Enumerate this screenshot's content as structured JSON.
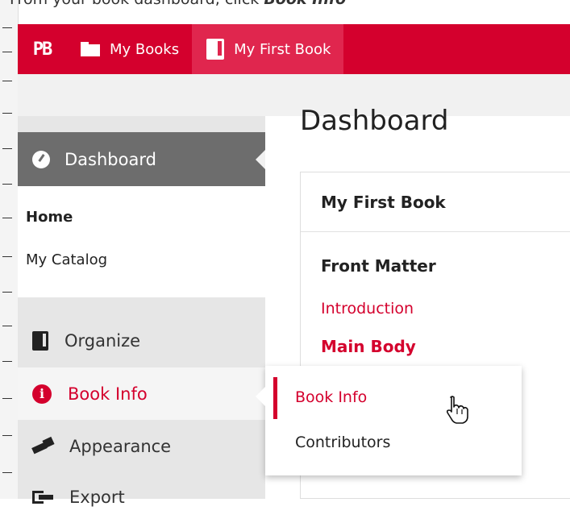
{
  "caption": {
    "prefix": "From your book dashboard, click ",
    "emphasis": "Book Info"
  },
  "adminbar": {
    "logo": "PB",
    "items": [
      {
        "label": "My Books",
        "icon": "folder-icon"
      },
      {
        "label": "My First Book",
        "icon": "book-icon"
      }
    ],
    "accent_color": "#d4002d"
  },
  "sidebar": {
    "current": {
      "label": "Dashboard",
      "icon": "gauge-icon"
    },
    "submenu": [
      {
        "label": "Home",
        "current": true
      },
      {
        "label": "My Catalog",
        "current": false
      }
    ],
    "items": [
      {
        "label": "Organize",
        "icon": "organize-icon"
      },
      {
        "label": "Book Info",
        "icon": "info-icon",
        "hover": true
      },
      {
        "label": "Appearance",
        "icon": "brush-icon"
      },
      {
        "label": "Export",
        "icon": "export-icon"
      }
    ]
  },
  "main": {
    "title": "Dashboard",
    "widget": {
      "heading": "My First Book",
      "section": "Front Matter",
      "link1": "Introduction",
      "link2": "Main Body"
    }
  },
  "flyout": {
    "items": [
      {
        "label": "Book Info",
        "current": true
      },
      {
        "label": "Contributors",
        "current": false
      }
    ]
  }
}
